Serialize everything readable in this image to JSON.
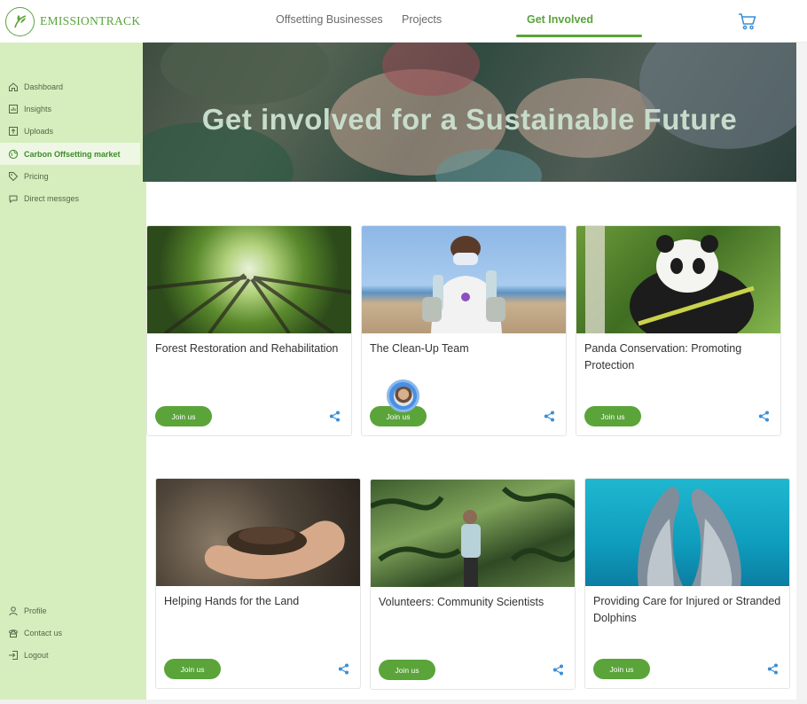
{
  "app": {
    "logo_text": "EMISSIONTRACK"
  },
  "sidebar": {
    "items": [
      {
        "label": "Dashboard",
        "icon": "home-icon"
      },
      {
        "label": "Insights",
        "icon": "chart-icon"
      },
      {
        "label": "Uploads",
        "icon": "upload-icon"
      },
      {
        "label": "Carbon Offsetting market",
        "icon": "globe-icon",
        "active": true
      },
      {
        "label": "Pricing",
        "icon": "tag-icon"
      },
      {
        "label": "Direct messges",
        "icon": "chat-icon"
      }
    ],
    "bottom_items": [
      {
        "label": "Profile",
        "icon": "user-icon"
      },
      {
        "label": "Contact us",
        "icon": "phone-icon"
      },
      {
        "label": "Logout",
        "icon": "logout-icon"
      }
    ]
  },
  "topbar": {
    "tabs": [
      {
        "label": "Offsetting Businesses"
      },
      {
        "label": "Projects"
      },
      {
        "label": "Get Involved",
        "active": true
      }
    ],
    "cart_icon": "cart-icon"
  },
  "hero": {
    "title": "Get involved for a Sustainable Future"
  },
  "cards": [
    {
      "title": "Forest Restoration and Rehabilitation",
      "button": "Join us"
    },
    {
      "title": "The Clean-Up Team",
      "button": "Join us"
    },
    {
      "title": "Panda Conservation: Promoting Protection",
      "button": "Join us"
    },
    {
      "title": "Helping Hands for the Land",
      "button": "Join us"
    },
    {
      "title": "Volunteers: Community Scientists",
      "button": "Join us"
    },
    {
      "title": "Providing Care for Injured or Stranded Dolphins",
      "button": "Join us"
    }
  ],
  "colors": {
    "accent": "#5aa43a",
    "sidebar_bg": "#d6edbe",
    "share": "#3a8fd6"
  }
}
